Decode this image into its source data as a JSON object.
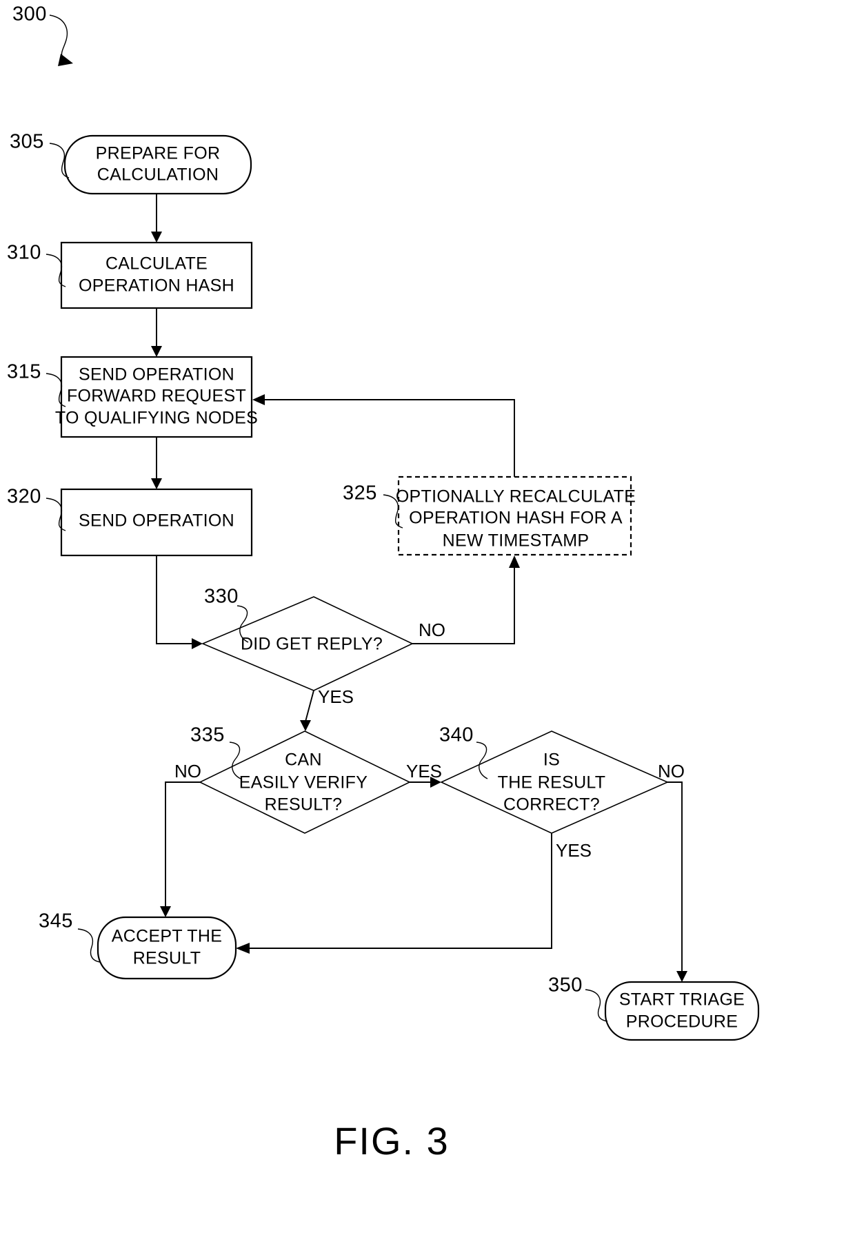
{
  "figure": {
    "number_label": "300",
    "caption": "FIG. 3"
  },
  "nodes": [
    {
      "ref": "305",
      "shape": "terminal",
      "lines": [
        "PREPARE FOR",
        "CALCULATION"
      ]
    },
    {
      "ref": "310",
      "shape": "process",
      "lines": [
        "CALCULATE",
        "OPERATION HASH"
      ]
    },
    {
      "ref": "315",
      "shape": "process",
      "lines": [
        "SEND OPERATION",
        "FORWARD REQUEST",
        "TO QUALIFYING NODES"
      ]
    },
    {
      "ref": "320",
      "shape": "process",
      "lines": [
        "SEND OPERATION"
      ]
    },
    {
      "ref": "325",
      "shape": "process-optional",
      "lines": [
        "OPTIONALLY RECALCULATE",
        "OPERATION HASH FOR A",
        "NEW TIMESTAMP"
      ]
    },
    {
      "ref": "330",
      "shape": "decision",
      "lines": [
        "DID GET REPLY?"
      ]
    },
    {
      "ref": "335",
      "shape": "decision",
      "lines": [
        "CAN",
        "EASILY VERIFY",
        "RESULT?"
      ]
    },
    {
      "ref": "340",
      "shape": "decision",
      "lines": [
        "IS",
        "THE RESULT",
        "CORRECT?"
      ]
    },
    {
      "ref": "345",
      "shape": "terminal",
      "lines": [
        "ACCEPT THE",
        "RESULT"
      ]
    },
    {
      "ref": "350",
      "shape": "terminal",
      "lines": [
        "START TRIAGE",
        "PROCEDURE"
      ]
    }
  ],
  "edge_labels": {
    "reply_no": "NO",
    "reply_yes": "YES",
    "verify_no": "NO",
    "verify_yes": "YES",
    "correct_no": "NO",
    "correct_yes": "YES"
  }
}
